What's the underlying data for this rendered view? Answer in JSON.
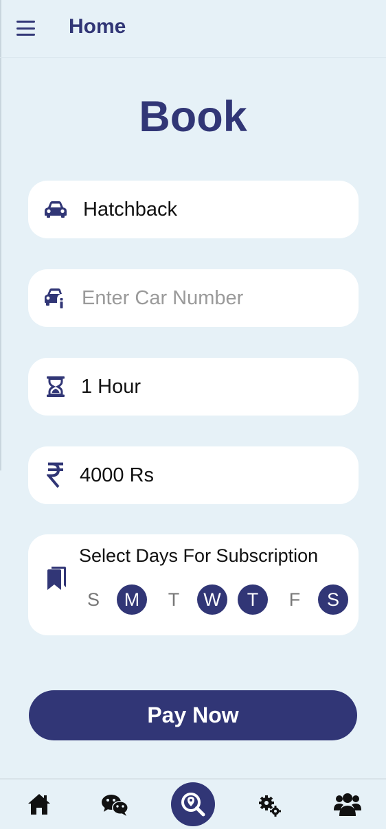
{
  "header": {
    "title": "Home",
    "menu_icon": "hamburger-menu-icon"
  },
  "page": {
    "title": "Book"
  },
  "form": {
    "car_type": {
      "value": "Hatchback",
      "icon": "car-icon"
    },
    "car_number": {
      "placeholder": "Enter Car Number",
      "value": "",
      "icon": "car-info-icon"
    },
    "duration": {
      "value": "1 Hour",
      "icon": "hourglass-icon"
    },
    "price": {
      "value": "4000 Rs",
      "icon": "rupee-icon"
    }
  },
  "subscription": {
    "title": "Select Days For Subscription",
    "icon": "bookmarks-icon",
    "days": [
      {
        "label": "S",
        "selected": false
      },
      {
        "label": "M",
        "selected": true
      },
      {
        "label": "T",
        "selected": false
      },
      {
        "label": "W",
        "selected": true
      },
      {
        "label": "T",
        "selected": true
      },
      {
        "label": "F",
        "selected": false
      },
      {
        "label": "S",
        "selected": true
      }
    ]
  },
  "actions": {
    "pay_label": "Pay Now"
  },
  "bottom_nav": [
    {
      "icon": "home-icon",
      "active": false
    },
    {
      "icon": "chat-icon",
      "active": false
    },
    {
      "icon": "location-search-icon",
      "active": true
    },
    {
      "icon": "settings-icon",
      "active": false
    },
    {
      "icon": "users-icon",
      "active": false
    }
  ],
  "colors": {
    "primary": "#313676",
    "background": "#e6f1f7",
    "card": "#ffffff",
    "placeholder": "#9a9a9a"
  }
}
